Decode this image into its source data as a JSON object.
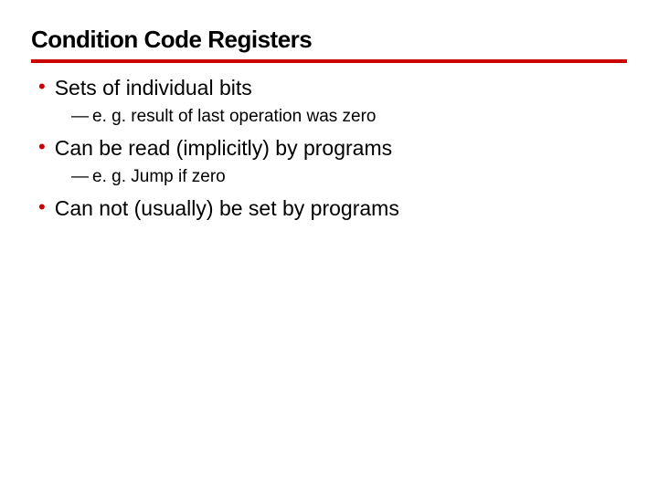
{
  "title": "Condition Code Registers",
  "items": [
    {
      "level": 1,
      "text": "Sets of individual bits"
    },
    {
      "level": 2,
      "text": "e. g. result of last operation was zero"
    },
    {
      "level": 1,
      "text": "Can be read (implicitly) by programs"
    },
    {
      "level": 2,
      "text": "e. g. Jump if zero"
    },
    {
      "level": 1,
      "text": "Can not (usually) be set by programs"
    }
  ]
}
